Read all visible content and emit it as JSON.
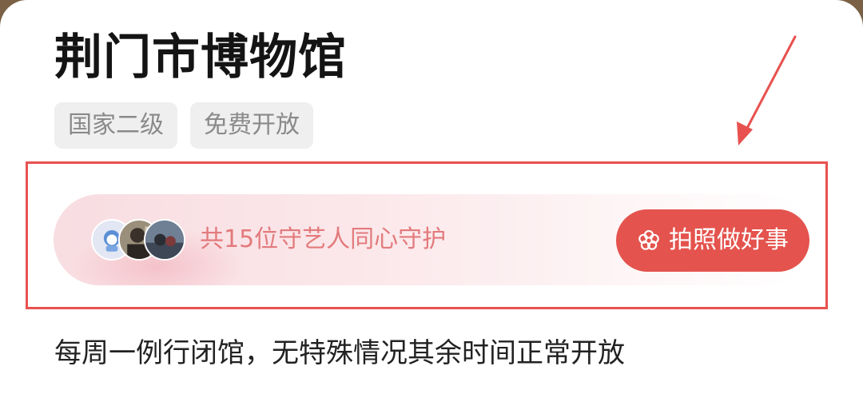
{
  "place": {
    "title": "荆门市博物馆",
    "tags": [
      "国家二级",
      "免费开放"
    ]
  },
  "guardian_card": {
    "text": "共15位守艺人同心守护",
    "button_label": "拍照做好事",
    "button_icon": "flower-icon",
    "avatar_count_shown": 3
  },
  "opening_info": "每周一例行闭馆，无特殊情况其余时间正常开放",
  "colors": {
    "accent": "#e4534d",
    "annotation": "#e8514f",
    "guardian_text": "#e37a7c"
  }
}
